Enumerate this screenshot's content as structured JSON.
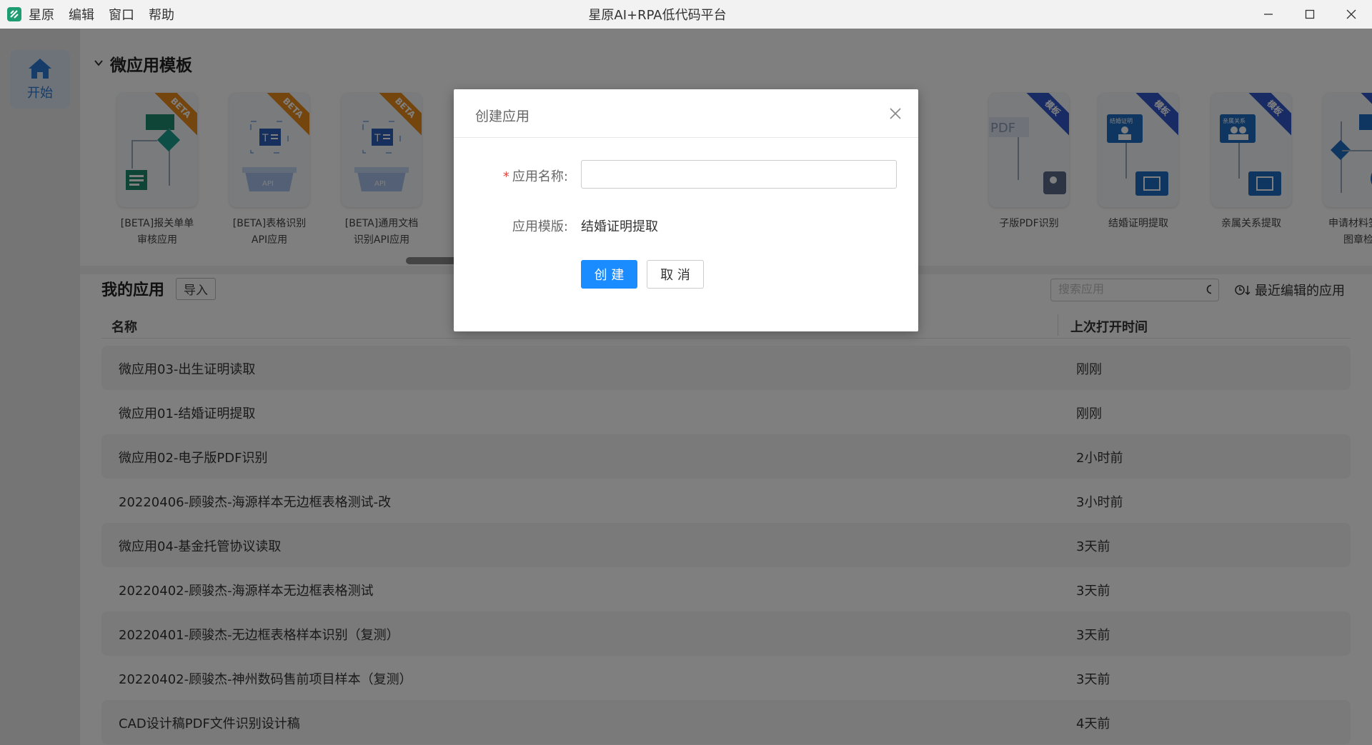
{
  "window": {
    "title": "星原AI+RPA低代码平台",
    "menu": [
      "星原",
      "编辑",
      "窗口",
      "帮助"
    ]
  },
  "sidebar": {
    "home_label": "开始"
  },
  "templates": {
    "title": "微应用模板",
    "items": [
      {
        "name_line1": "[BETA]报关单单",
        "name_line2": "审核应用",
        "badge": "BETA",
        "badge_color": "#e88a1a"
      },
      {
        "name_line1": "[BETA]表格识别",
        "name_line2": "API应用",
        "badge": "BETA",
        "badge_color": "#e88a1a"
      },
      {
        "name_line1": "[BETA]通用文档",
        "name_line2": "识别API应用",
        "badge": "BETA",
        "badge_color": "#e88a1a"
      },
      {
        "name_line1": "子版PDF识别",
        "name_line2": "",
        "badge": "模板",
        "badge_color": "#3357c9",
        "thumb_text": "PDF"
      },
      {
        "name_line1": "结婚证明提取",
        "name_line2": "",
        "badge": "模板",
        "badge_color": "#3357c9",
        "thumb_text": "结婚证明"
      },
      {
        "name_line1": "亲属关系提取",
        "name_line2": "",
        "badge": "模板",
        "badge_color": "#3357c9",
        "thumb_text": "亲属关系"
      },
      {
        "name_line1": "申请材料签字、",
        "name_line2": "图章检查",
        "badge": "模板",
        "badge_color": "#3357c9"
      }
    ]
  },
  "apps": {
    "title": "我的应用",
    "import_label": "导入",
    "search_placeholder": "搜索应用",
    "recent_label": "最近编辑的应用",
    "columns": {
      "name": "名称",
      "last_open": "上次打开时间"
    },
    "rows": [
      {
        "name": "微应用03-出生证明读取",
        "time": "刚刚"
      },
      {
        "name": "微应用01-结婚证明提取",
        "time": "刚刚"
      },
      {
        "name": "微应用02-电子版PDF识别",
        "time": "2小时前"
      },
      {
        "name": "20220406-顾骏杰-海源样本无边框表格测试-改",
        "time": "3小时前"
      },
      {
        "name": "微应用04-基金托管协议读取",
        "time": "3天前"
      },
      {
        "name": "20220402-顾骏杰-海源样本无边框表格测试",
        "time": "3天前"
      },
      {
        "name": "20220401-顾骏杰-无边框表格样本识别（复测）",
        "time": "3天前"
      },
      {
        "name": "20220402-顾骏杰-神州数码售前项目样本（复测）",
        "time": "3天前"
      },
      {
        "name": "CAD设计稿PDF文件识别设计稿",
        "time": "4天前"
      }
    ]
  },
  "modal": {
    "title": "创建应用",
    "name_label": "应用名称:",
    "name_value": "",
    "template_label": "应用模版:",
    "template_value": "结婚证明提取",
    "create_label": "创 建",
    "cancel_label": "取 消",
    "required_mark": "*"
  },
  "colors": {
    "primary": "#1a8cff",
    "beta": "#e88a1a",
    "template": "#3357c9",
    "required": "#e8443a"
  }
}
